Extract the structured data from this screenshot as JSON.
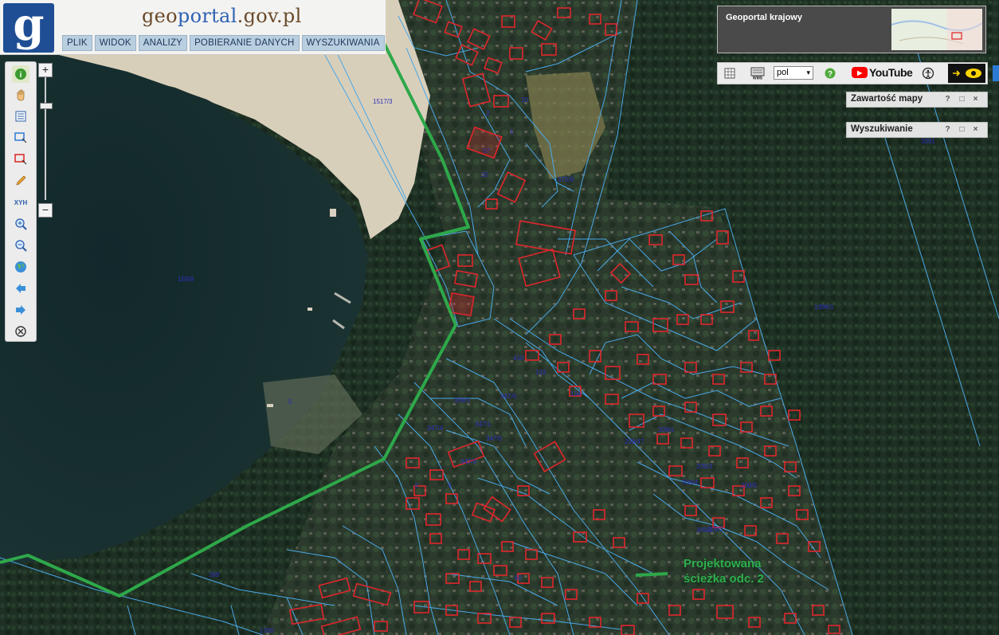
{
  "header": {
    "logo_letter": "g",
    "site_title_pre": "geo",
    "site_title_mid": "portal",
    "site_title_post": ".gov.pl",
    "menu": [
      "PLIK",
      "WIDOK",
      "ANALIZY",
      "POBIERANIE DANYCH",
      "WYSZUKIWANIA"
    ]
  },
  "toolbar": {
    "tools": [
      "info-icon",
      "pan-hand-icon",
      "legend-icon",
      "select-rectangle-icon",
      "select-delete-icon",
      "pencil-icon",
      "xyh-icon",
      "zoom-in-icon",
      "zoom-out-icon",
      "globe-icon",
      "back-arrow-icon",
      "forward-arrow-icon",
      "close-circle-icon"
    ],
    "xyh_label": "XYH"
  },
  "zoom": {
    "plus": "+",
    "minus": "−",
    "level": 0.21
  },
  "minimap": {
    "label": "Geoportal krajowy"
  },
  "topbar": {
    "language": "pol",
    "youtube_label": "YouTube",
    "help_symbol": "?"
  },
  "panels": [
    {
      "title": "Zawartość mapy",
      "help": "?",
      "min": "□",
      "close": "×"
    },
    {
      "title": "Wyszukiwanie",
      "help": "?",
      "min": "□",
      "close": "×"
    }
  ],
  "map": {
    "annotation_line1": "Projektowana",
    "annotation_line2": "ścieżka odc. 2",
    "parcel_labels": [
      "408",
      "1517/3",
      "159/9",
      "339/1",
      "347/1",
      "347/3",
      "347/4",
      "347/5",
      "347/6",
      "375/9",
      "5",
      "133",
      "134",
      "1",
      "2",
      "10",
      "57",
      "60",
      "269",
      "3",
      "4",
      "25",
      "410",
      "209/4",
      "209/3",
      "209/5",
      "209/47",
      "209/2",
      "309/2",
      "3391",
      "1396/1",
      "209/1",
      "1330"
    ],
    "colors": {
      "water": "#172c2c",
      "beach": "#d9d0bd",
      "forest": "#1f3223",
      "parcel_line": "#4aa8e8",
      "building": "#e0262c",
      "path": "#2ea84a"
    }
  }
}
